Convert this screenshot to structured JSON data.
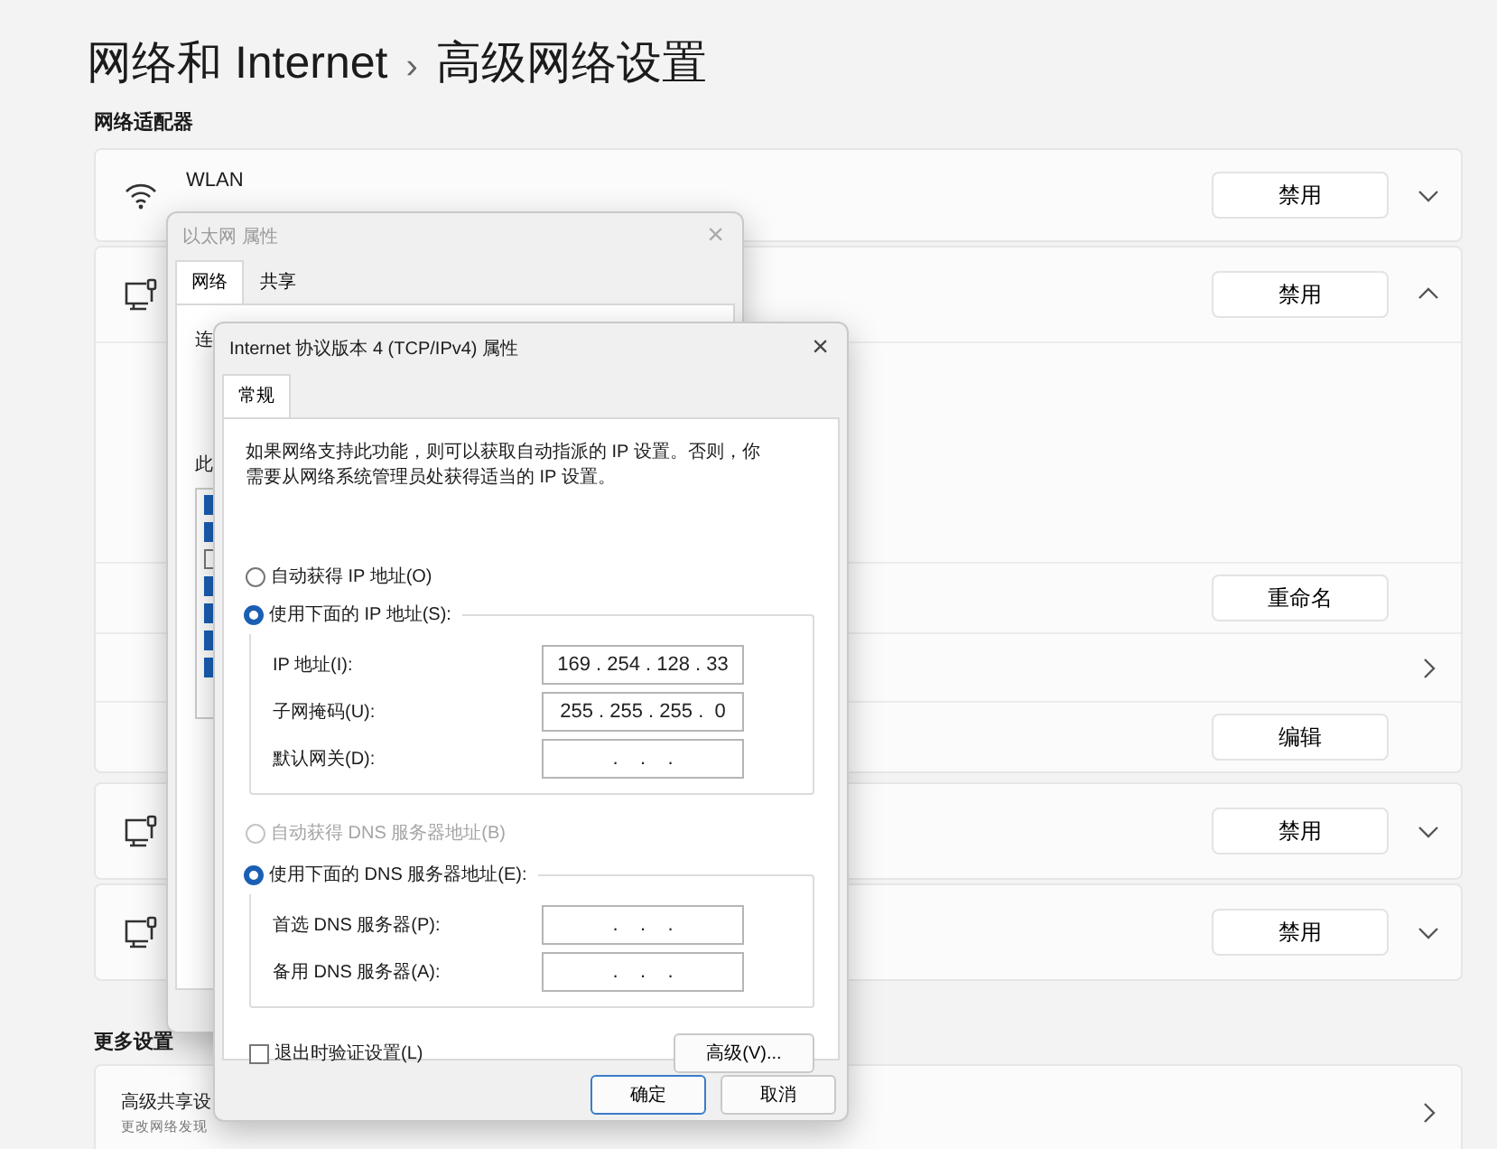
{
  "page": {
    "breadcrumb": "网络和 Internet",
    "separator": "›",
    "title": "高级网络设置"
  },
  "adapters_heading": "网络适配器",
  "adapters": [
    {
      "kind": "wifi",
      "name": "WLAN",
      "button": "禁用",
      "expanded": false
    },
    {
      "kind": "ethernet",
      "button": "禁用",
      "expanded": true,
      "subrows": [
        {
          "kind": "blank"
        },
        {
          "kind": "button",
          "button": "重命名"
        },
        {
          "kind": "link"
        },
        {
          "kind": "button",
          "button": "编辑"
        }
      ]
    },
    {
      "kind": "ethernet",
      "button": "禁用",
      "expanded": false
    },
    {
      "kind": "ethernet",
      "button": "禁用",
      "expanded": false
    }
  ],
  "more_heading": "更多设置",
  "more_items": [
    {
      "title": "高级共享设",
      "subtitle": "更改网络发现"
    }
  ],
  "ethernet_dialog": {
    "title": "以太网 属性",
    "close": "×",
    "tabs": [
      {
        "label": "网络",
        "selected": true
      },
      {
        "label": "共享",
        "selected": false
      }
    ],
    "connect_label": "连",
    "items_label": "此",
    "items": [
      {
        "checked": true
      },
      {
        "checked": true
      },
      {
        "checked": false
      },
      {
        "checked": true
      },
      {
        "checked": true
      },
      {
        "checked": true
      },
      {
        "checked": true
      }
    ]
  },
  "ipv4_dialog": {
    "title": "Internet 协议版本 4 (TCP/IPv4) 属性",
    "close": "×",
    "tabs": [
      {
        "label": "常规",
        "selected": true
      }
    ],
    "description": "如果网络支持此功能，则可以获取自动指派的 IP 设置。否则，你需要从网络系统管理员处获得适当的 IP 设置。",
    "ip_auto": {
      "label": "自动获得 IP 地址(O)",
      "selected": false
    },
    "ip_manual": {
      "label": "使用下面的 IP 地址(S):",
      "selected": true
    },
    "ip_fields": [
      {
        "label": "IP 地址(I):",
        "value": "169 . 254 . 128 . 33"
      },
      {
        "label": "子网掩码(U):",
        "value": "255 . 255 . 255 .  0"
      },
      {
        "label": "默认网关(D):",
        "value": ".    .    ."
      }
    ],
    "dns_auto": {
      "label": "自动获得 DNS 服务器地址(B)",
      "selected": false,
      "disabled": true
    },
    "dns_manual": {
      "label": "使用下面的 DNS 服务器地址(E):",
      "selected": true
    },
    "dns_fields": [
      {
        "label": "首选 DNS 服务器(P):",
        "value": ".    .    ."
      },
      {
        "label": "备用 DNS 服务器(A):",
        "value": ".    .    ."
      }
    ],
    "validate": {
      "label": "退出时验证设置(L)",
      "checked": false
    },
    "advanced_button": "高级(V)...",
    "buttons": [
      {
        "label": "确定",
        "default": true
      },
      {
        "label": "取消",
        "default": false
      }
    ]
  }
}
